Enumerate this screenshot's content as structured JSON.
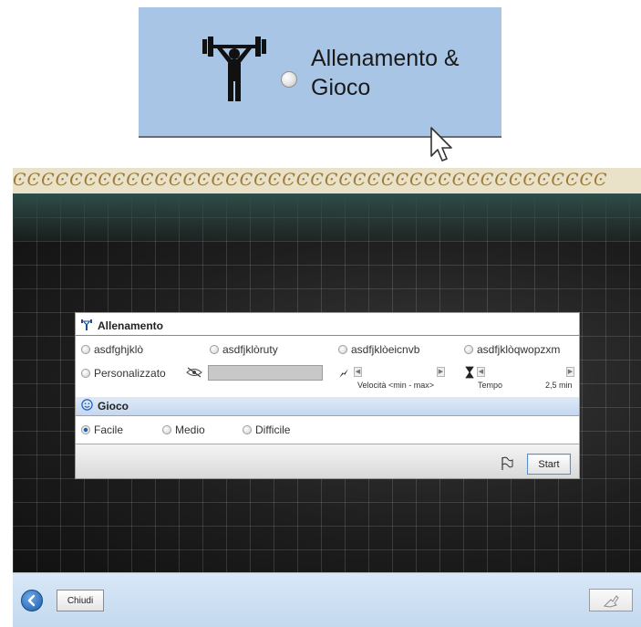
{
  "callout": {
    "label_line1": "Allenamento &",
    "label_line2": "Gioco",
    "icon": "weightlifter-icon",
    "cursor": "mouse-pointer-icon"
  },
  "rings_text": "ϾϾϾϾϾϾϾϾϾϾϾϾϾϾϾϾϾϾϾϾϾϾϾϾϾϾϾϾϾϾϾϾϾϾϾϾϾϾϾϾϾϾ",
  "dialog": {
    "allenamento": {
      "title": "Allenamento",
      "options": [
        "asdfghjklò",
        "asdfjklòruty",
        "asdfjklòeicnvb",
        "asdfjklòqwopzxm"
      ],
      "custom_label": "Personalizzato",
      "speed_label": "Velocità <min - max>",
      "time_label": "Tempo",
      "time_value": "2,5 min"
    },
    "gioco": {
      "title": "Gioco",
      "options": [
        "Facile",
        "Medio",
        "Difficile"
      ],
      "selected": "Facile"
    },
    "start_label": "Start"
  },
  "bottom": {
    "close_label": "Chiudi"
  },
  "colors": {
    "accent": "#1f5fb4",
    "callout_bg": "#a9c5e5",
    "board_bg": "#1a1a1a",
    "bottom_bar": "#c3d8ee"
  }
}
